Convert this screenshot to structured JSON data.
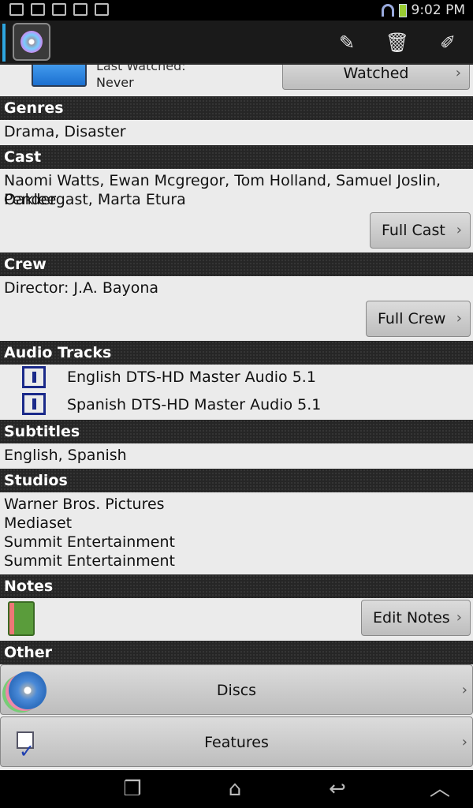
{
  "status_bar": {
    "time": "9:02 PM"
  },
  "action_bar": {
    "edit_icon": "pencil-icon",
    "delete_icon": "trash-icon",
    "tag_icon": "tag-pencil-icon"
  },
  "top": {
    "last_watched_label": "Last Watched:",
    "last_watched_value": "Never",
    "watched_button": "Watched"
  },
  "sections": {
    "genres": {
      "title": "Genres",
      "value": "Drama, Disaster"
    },
    "cast": {
      "title": "Cast",
      "line1": "Naomi Watts, Ewan Mcgregor, Tom Holland, Samuel Joslin, Oaklee",
      "line2": "Pendergast, Marta Etura",
      "button": "Full Cast"
    },
    "crew": {
      "title": "Crew",
      "value": "Director: J.A. Bayona",
      "button": "Full Crew"
    },
    "audio": {
      "title": "Audio Tracks",
      "tracks": [
        "English DTS-HD Master Audio 5.1",
        "Spanish DTS-HD Master Audio 5.1"
      ]
    },
    "subtitles": {
      "title": "Subtitles",
      "value": "English, Spanish"
    },
    "studios": {
      "title": "Studios",
      "items": [
        "Warner Bros. Pictures",
        "Mediaset",
        "Summit Entertainment",
        "Summit Entertainment"
      ]
    },
    "notes": {
      "title": "Notes",
      "button": "Edit Notes"
    },
    "other": {
      "title": "Other",
      "discs": "Discs",
      "features": "Features"
    }
  },
  "chevron": "›"
}
